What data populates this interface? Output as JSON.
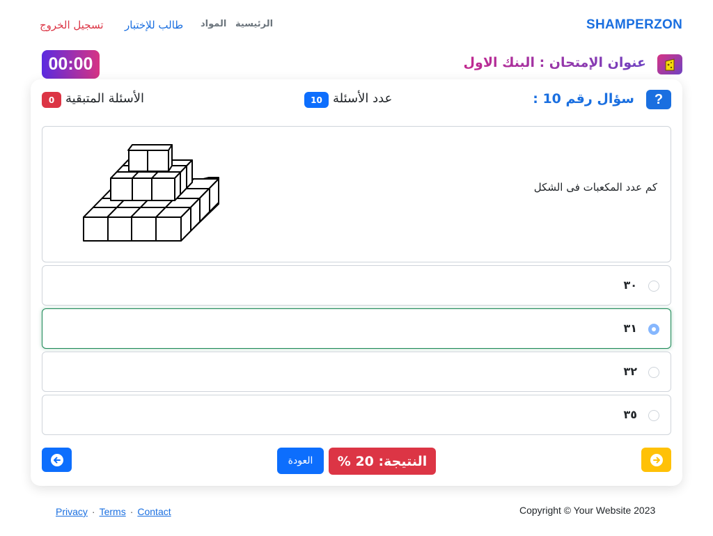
{
  "navbar": {
    "brand": "SHAMPERZON",
    "home": "الرئيسية",
    "subjects": "المواد",
    "student": "طالب للإختبار",
    "logout": "تسجيل الخروج"
  },
  "exam": {
    "title": "عنوان الإمتحان : البنك الاول",
    "timer": "00:00"
  },
  "header": {
    "question_number": "سؤال رقم 10 :",
    "questions_count_label": "عدد الأسئلة",
    "questions_count": "10",
    "remaining_label": "الأسئلة المتبقية",
    "remaining": "0"
  },
  "question": {
    "text": "كم عدد المكعبات فى الشكل"
  },
  "options": [
    {
      "label": "٣٠",
      "selected": false
    },
    {
      "label": "٣١",
      "selected": true
    },
    {
      "label": "٣٢",
      "selected": false
    },
    {
      "label": "٣٥",
      "selected": false
    }
  ],
  "controls": {
    "back": "العودة",
    "score": "النتيجة: 20 %"
  },
  "colors": {
    "primary": "#0d6efd",
    "danger": "#dc3545",
    "warning": "#ffc107",
    "success": "#198754"
  },
  "footer": {
    "privacy": "Privacy",
    "terms": "Terms",
    "contact": "Contact",
    "separator": "·",
    "copyright": "Copyright © Your Website 2023"
  }
}
